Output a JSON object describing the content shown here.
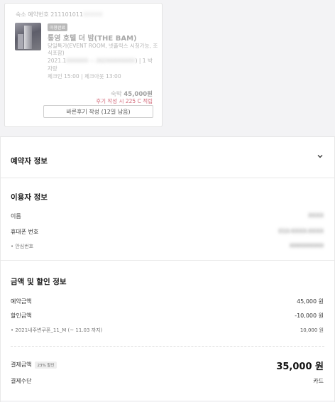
{
  "reservation": {
    "number_label": "숙소 예약번호",
    "number_value": "211101011",
    "number_masked": "XXXXX",
    "badge": "이용완료",
    "hotel_name": "통영 호텔 더 밤(THE BAM)",
    "room_name": "당일특가(EVENT ROOM, 넷플릭스 시청가능, 조식포함)",
    "dates_start": "2021.1",
    "dates_masked": "XXXXXX ~ 202",
    "dates_masked2": "XXXXXXXX",
    "dates_suffix": ") | 1 박",
    "stay_type": "자랑",
    "check_times": "체크인 15:00 | 체크아웃 13:00",
    "price_label": "숙박",
    "price_value": "45,000원",
    "points_text": "후기 작성 시 225 C 적립",
    "review_button": "바른후기 작성 (12일 남음)"
  },
  "booker_section": {
    "title": "예약자 정보"
  },
  "user_section": {
    "title": "이용자 정보",
    "name_label": "이름",
    "name_value": "XXXX",
    "phone_label": "휴대폰 번호",
    "phone_value": "010-XXXX-XXXX",
    "safe_label": "• 안심번호",
    "safe_value": "XXXXXXXXXX"
  },
  "payment_section": {
    "title": "금액 및 할인 정보",
    "booking_amount_label": "예약금액",
    "booking_amount_value": "45,000 원",
    "discount_label": "할인금액",
    "discount_value": "-10,000 원",
    "coupon_label": "• 2021내주변쿠폰_11_M (~ 11.03 까지)",
    "coupon_value": "10,000 원",
    "paid_label": "결제금액",
    "paid_chip": "23% 할인",
    "paid_value": "35,000 원",
    "method_label": "결제수단",
    "method_value": "카드"
  },
  "icons": {
    "chevron": "chevron-down-icon"
  }
}
